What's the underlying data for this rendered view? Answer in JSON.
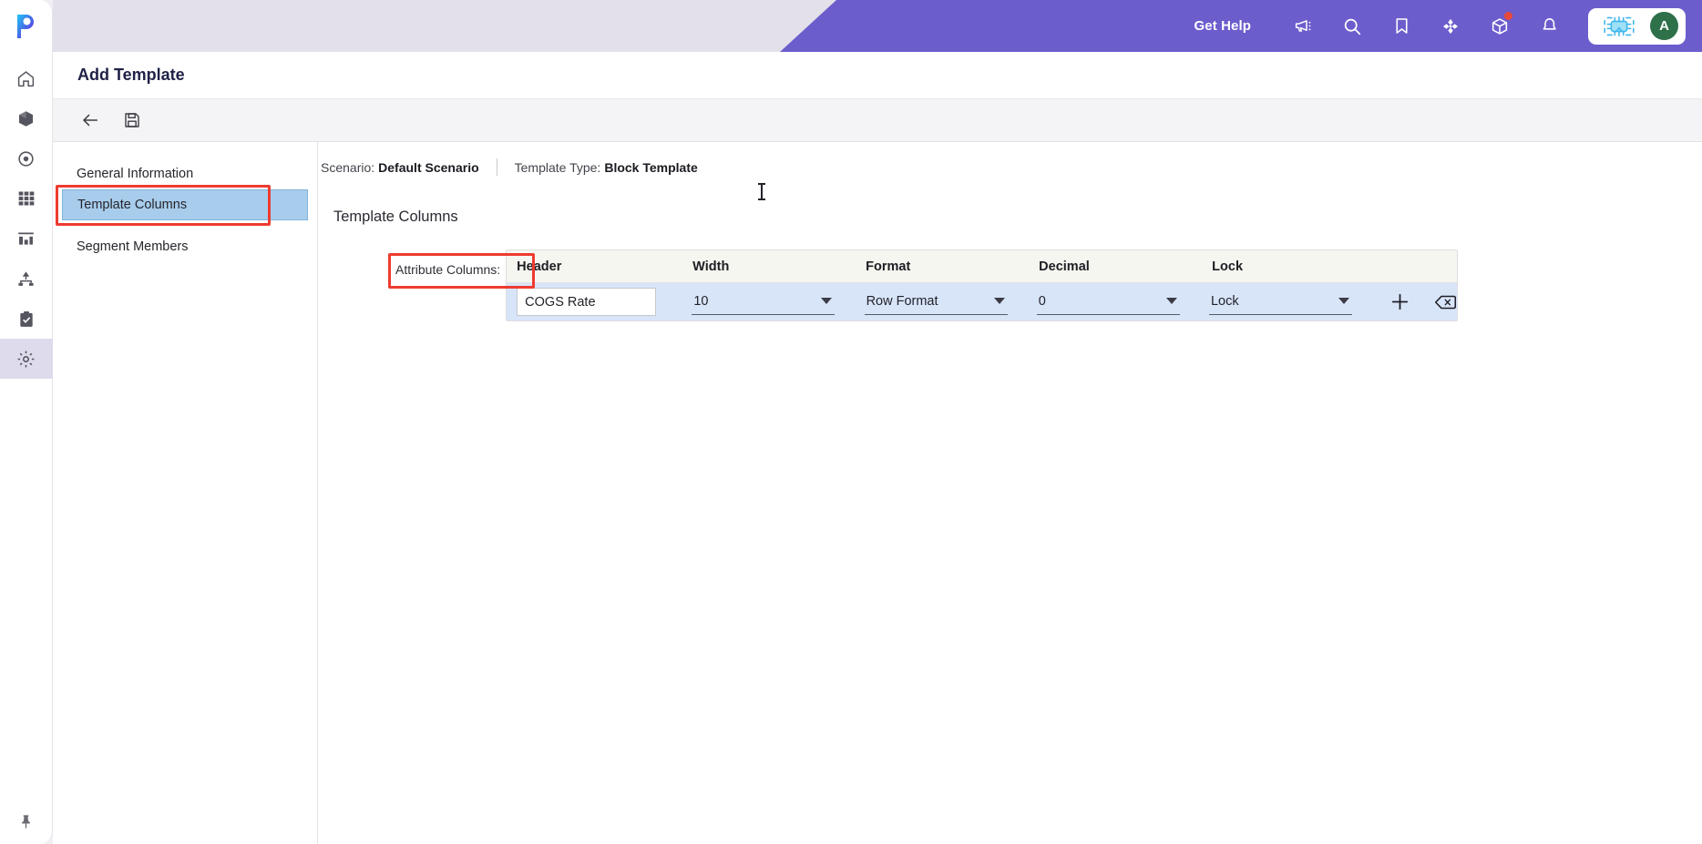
{
  "app": {
    "logo_alt": "p-logo",
    "page_title": "Add Template"
  },
  "rail": {
    "items": [
      {
        "id": "home",
        "icon": "home-icon",
        "label": "Home",
        "active": false
      },
      {
        "id": "models",
        "icon": "cube-icon",
        "label": "Models",
        "active": false
      },
      {
        "id": "targets",
        "icon": "target-icon",
        "label": "Targets",
        "active": false
      },
      {
        "id": "grid",
        "icon": "grid-icon",
        "label": "Grid",
        "active": false
      },
      {
        "id": "reports",
        "icon": "bar-chart-icon",
        "label": "Reports",
        "active": false
      },
      {
        "id": "hierarchy",
        "icon": "hierarchy-icon",
        "label": "Hierarchy",
        "active": false
      },
      {
        "id": "tasks",
        "icon": "clipboard-check-icon",
        "label": "Tasks",
        "active": false
      },
      {
        "id": "settings",
        "icon": "gear-icon",
        "label": "Settings",
        "active": true
      }
    ],
    "pin": {
      "icon": "pin-icon",
      "label": "Pin navigation"
    }
  },
  "topbar": {
    "get_help": "Get Help",
    "icons": [
      {
        "id": "announcements",
        "icon": "megaphone-icon",
        "badge": false
      },
      {
        "id": "search",
        "icon": "search-icon",
        "badge": false
      },
      {
        "id": "bookmarks",
        "icon": "bookmark-icon",
        "badge": false
      },
      {
        "id": "focus",
        "icon": "crosshair-icon",
        "badge": false
      },
      {
        "id": "packages",
        "icon": "box-icon",
        "badge": true
      },
      {
        "id": "notifications",
        "icon": "bell-icon",
        "badge": false
      }
    ],
    "assistant_icon": "ai-chip-icon",
    "avatar_initial": "A"
  },
  "toolbar": {
    "back_label": "Back",
    "back_icon": "arrow-left-icon",
    "save_label": "Save",
    "save_icon": "save-disk-icon"
  },
  "left_nav": {
    "items": [
      {
        "label": "General Information",
        "selected": false,
        "highlighted": false
      },
      {
        "label": "Template Columns",
        "selected": true,
        "highlighted": true
      },
      {
        "label": "Segment Members",
        "selected": false,
        "highlighted": false
      }
    ]
  },
  "main": {
    "meta": {
      "scenario_key": "Scenario:",
      "scenario_value": "Default Scenario",
      "template_type_key": "Template Type:",
      "template_type_value": "Block Template"
    },
    "section_title": "Template Columns",
    "attribute_columns_label": "Attribute Columns:",
    "grid": {
      "columns": [
        "Header",
        "Width",
        "Format",
        "Decimal",
        "Lock"
      ],
      "rows": [
        {
          "header": "COGS Rate",
          "width": "10",
          "format": "Row Format",
          "decimal": "0",
          "lock": "Lock",
          "add_icon": "plus-icon",
          "delete_icon": "backspace-delete-icon"
        }
      ]
    }
  },
  "colors": {
    "brand_purple": "#6C5DCD",
    "topbar_lavender": "#E4E0EA",
    "nav_selected": "#A8CDEC",
    "highlight_red": "#EE3B30",
    "grid_header_bg": "#F6F6F0",
    "grid_row_bg": "#D8E5F9",
    "avatar_green": "#2D7049"
  }
}
